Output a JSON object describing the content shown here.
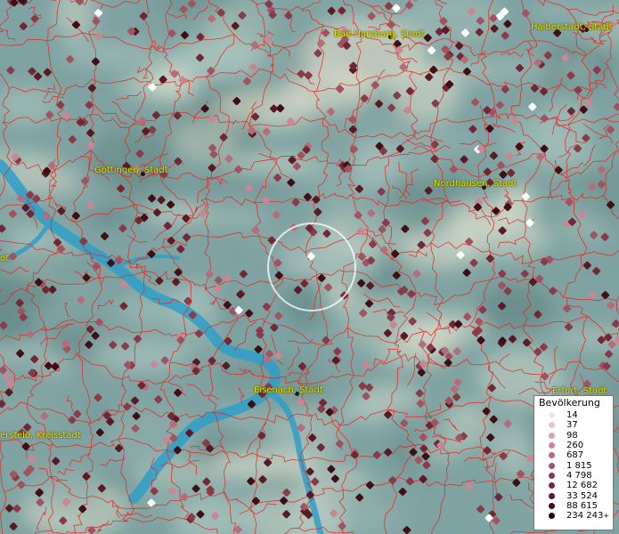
{
  "map": {
    "cities": [
      {
        "name": "Bad Harzburg, Stadt"
      },
      {
        "name": "Halberstadt, Stadt"
      },
      {
        "name": "Göttingen, Stadt"
      },
      {
        "name": "Nordhausen, Stadt"
      },
      {
        "name": "Eisenach, Stadt"
      },
      {
        "name": "Erfurt, Stadt"
      },
      {
        "name": "ersfeld, Kreisstadt"
      },
      {
        "name": "dt"
      }
    ],
    "colors": {
      "terrain_base": "#7fa3a2",
      "boundary": "#e8261e",
      "river": "#2f9fc8",
      "label": "#e8e800"
    }
  },
  "legend": {
    "title": "Bevölkerung",
    "items": [
      {
        "label": "14",
        "color": "#f6e1ea"
      },
      {
        "label": "37",
        "color": "#e9c2cd"
      },
      {
        "label": "98",
        "color": "#d9a2b0"
      },
      {
        "label": "260",
        "color": "#c98794"
      },
      {
        "label": "687",
        "color": "#b66d7a"
      },
      {
        "label": "1 815",
        "color": "#a15361"
      },
      {
        "label": "4 798",
        "color": "#8a3b49"
      },
      {
        "label": "12 682",
        "color": "#722834"
      },
      {
        "label": "33 524",
        "color": "#5a1a24"
      },
      {
        "label": "88 615",
        "color": "#3f0f16"
      },
      {
        "label": "234 243",
        "color": "#1f060a",
        "suffix": "+"
      }
    ]
  }
}
